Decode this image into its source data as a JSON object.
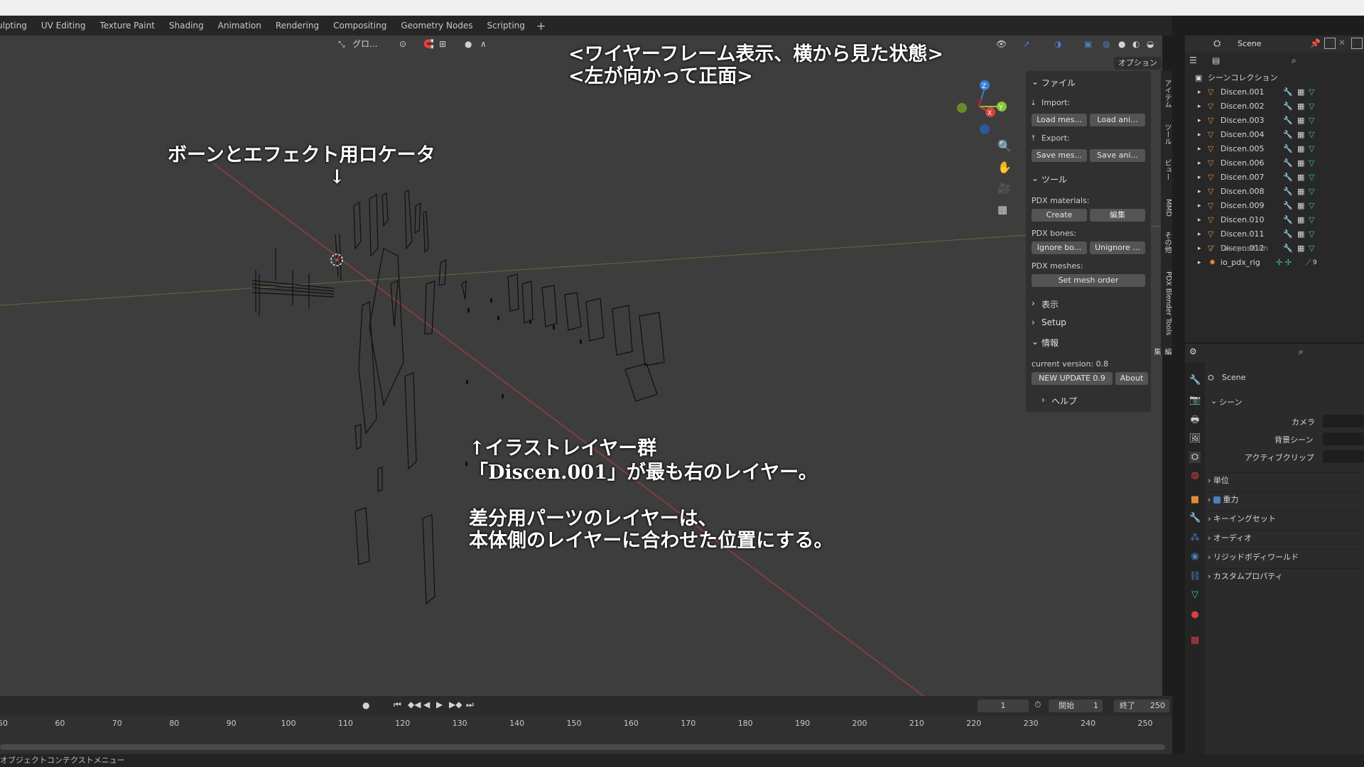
{
  "workspace_tabs": [
    "ulpting",
    "UV Editing",
    "Texture Paint",
    "Shading",
    "Animation",
    "Rendering",
    "Compositing",
    "Geometry Nodes",
    "Scripting"
  ],
  "viewport": {
    "transform_orientation": "グロ...",
    "options_label": "オプション",
    "annotations": {
      "title_line1": "<ワイヤーフレーム表示、横から見た状態>",
      "title_line2": "<左が向かって正面>",
      "bones_label": "ボーンとエフェクト用ロケータ",
      "bones_arrow": "↓",
      "layers_line1": "↑イラストレイヤー群",
      "layers_line2": "「Discen.001」が最も右のレイヤー。",
      "parts_line1": "差分用パーツのレイヤーは、",
      "parts_line2": "本体側のレイヤーに合わせた位置にする。"
    },
    "gizmo": {
      "z": "Z",
      "y": "Y",
      "x": "X"
    }
  },
  "npanel": {
    "file_header": "ファイル",
    "import_label": "Import:",
    "load_mesh": "Load mes...",
    "load_anim": "Load ani...",
    "export_label": "Export:",
    "save_mesh": "Save mes...",
    "save_anim": "Save ani...",
    "tools_header": "ツール",
    "pdx_materials": "PDX materials:",
    "create": "Create",
    "edit": "編集",
    "pdx_bones": "PDX bones:",
    "ignore_bones": "Ignore bo...",
    "unignore": "Unignore ...",
    "pdx_meshes": "PDX meshes:",
    "set_mesh_order": "Set mesh order",
    "display_header": "表示",
    "setup_header": "Setup",
    "info_header": "情報",
    "current_version": "current version: 0.8",
    "new_update": "NEW UPDATE 0.9",
    "about": "About",
    "help_header": "ヘルプ"
  },
  "vertical_tabs": [
    "アイテム",
    "ツール",
    "ビュー",
    "MMD",
    "その他",
    "PDX Blender Tools",
    "編集"
  ],
  "outliner": {
    "scene_name": "Scene",
    "collection": "シーンコレクション",
    "items": [
      "Discen.001",
      "Discen.002",
      "Discen.003",
      "Discen.004",
      "Discen.005",
      "Discen.006",
      "Discen.007",
      "Discen.008",
      "Discen.009",
      "Discen.010",
      "Discen.011",
      "Discen.012"
    ],
    "faceposition": "faceposition",
    "rig": "io_pdx_rig",
    "rig_count": "9"
  },
  "properties": {
    "scene_name": "Scene",
    "section_scene": "シーン",
    "camera_label": "カメラ",
    "bg_scene_label": "背景シーン",
    "active_clip_label": "アクティブクリップ",
    "sections": [
      "単位",
      "重力",
      "キーイングセット",
      "オーディオ",
      "リジッドボディワールド",
      "カスタムプロパティ"
    ]
  },
  "timeline": {
    "current_frame": "1",
    "start_label": "開始",
    "start_value": "1",
    "end_label": "終了",
    "end_value": "250",
    "ticks": [
      "50",
      "60",
      "70",
      "80",
      "90",
      "100",
      "110",
      "120",
      "130",
      "140",
      "150",
      "160",
      "170",
      "180",
      "190",
      "200",
      "210",
      "220",
      "230",
      "240",
      "250"
    ]
  },
  "status": {
    "text": "オブジェクトコンテクストメニュー"
  },
  "colors": {
    "accent_blue": "#4a7fc1",
    "mesh_icon": "#e08a3c",
    "data_icon": "#3fc48a",
    "axis_x": "#d9403e",
    "axis_y": "#8ac63a",
    "axis_z": "#3b7fd6"
  }
}
